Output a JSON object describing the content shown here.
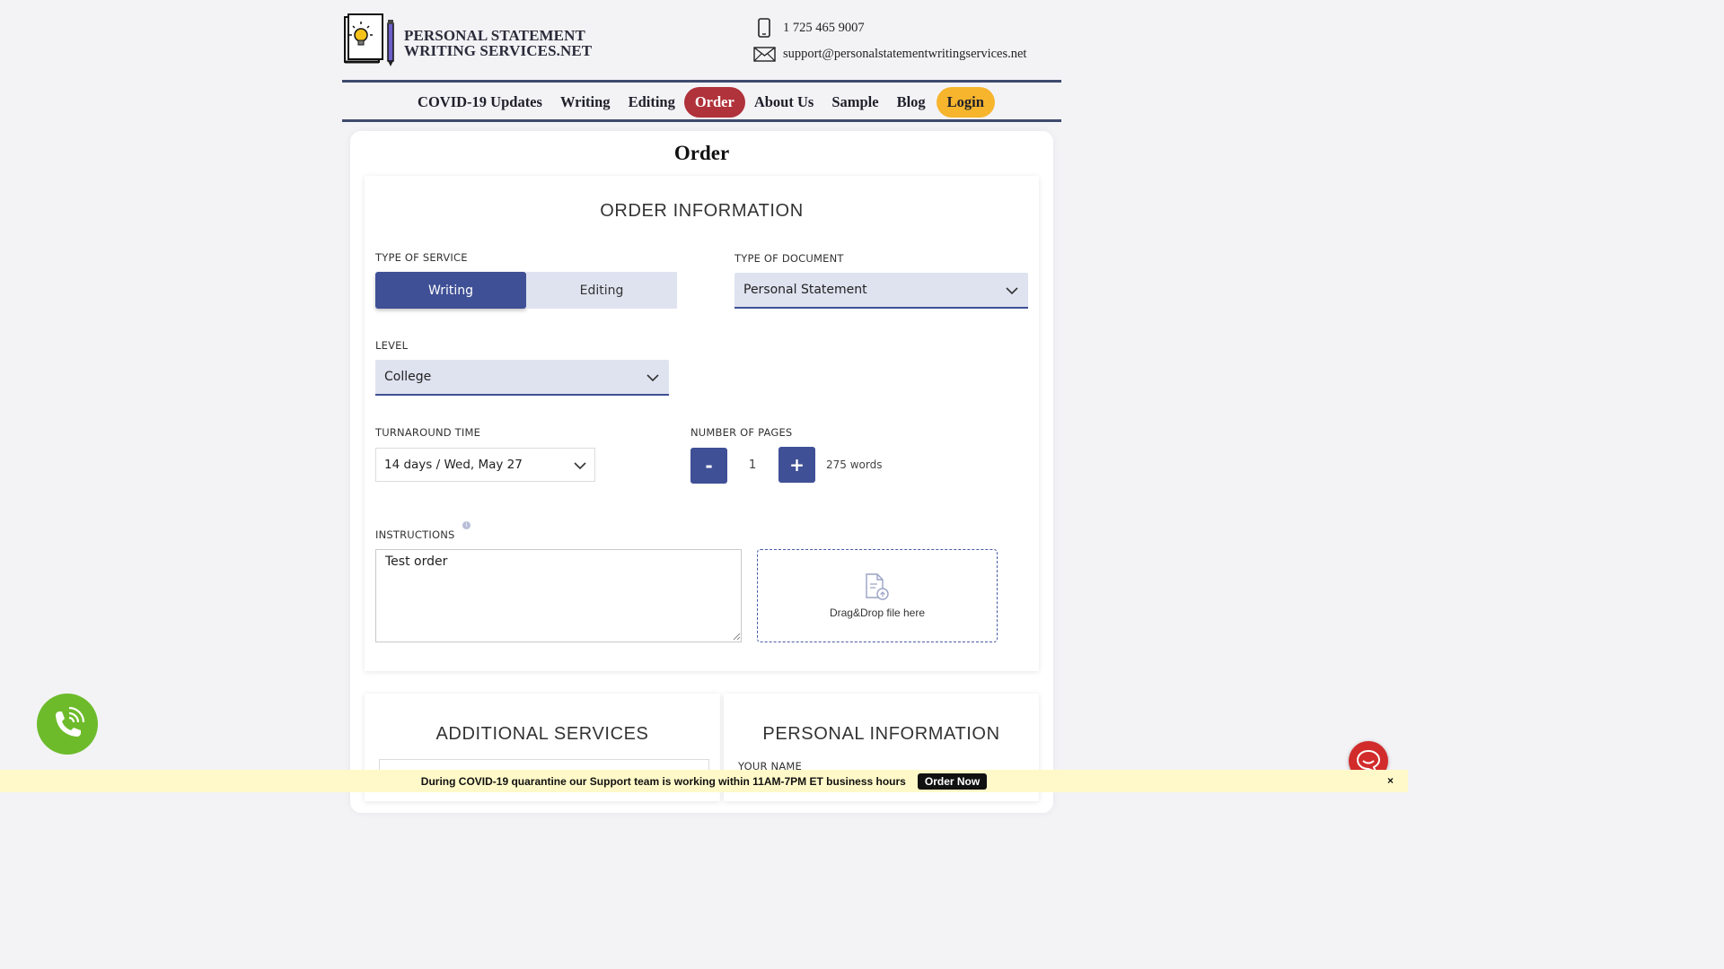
{
  "site": {
    "logo_line1": "PERSONAL STATEMENT",
    "logo_line2": "WRITING SERVICES.NET",
    "phone": "1 725 465 9007",
    "email": "support@personalstatementwritingservices.net"
  },
  "nav": {
    "items": [
      "COVID-19 Updates",
      "Writing",
      "Editing",
      "Order",
      "About Us",
      "Sample",
      "Blog",
      "Login"
    ]
  },
  "page_title": "Order",
  "order_info": {
    "title": "ORDER INFORMATION",
    "service_label": "TYPE OF SERVICE",
    "service_options": [
      "Writing",
      "Editing"
    ],
    "service_selected": "Writing",
    "document_label": "TYPE OF DOCUMENT",
    "document_value": "Personal Statement",
    "level_label": "LEVEL",
    "level_value": "College",
    "turnaround_label": "TURNAROUND TIME",
    "turnaround_value": "14 days / Wed, May 27",
    "pages_label": "NUMBER OF PAGES",
    "pages_minus": "-",
    "pages_plus": "+",
    "pages_value": "1",
    "words": "275 words",
    "instructions_label": "INSTRUCTIONS",
    "instructions_value": "Test order",
    "dropzone_text": "Drag&Drop file here"
  },
  "additional": {
    "title": "ADDITIONAL SERVICES"
  },
  "personal": {
    "title": "PERSONAL INFORMATION",
    "name_label": "YOUR NAME"
  },
  "banner": {
    "text": "During COVID-19 quarantine our Support team is working within 11AM-7PM ET business hours",
    "button": "Order Now",
    "close": "×"
  },
  "colors": {
    "primary": "#3f5096",
    "order_nav": "#b0323a",
    "login_nav": "#f6b52d",
    "call": "#6dbb2b",
    "chat": "#d22b2b"
  }
}
